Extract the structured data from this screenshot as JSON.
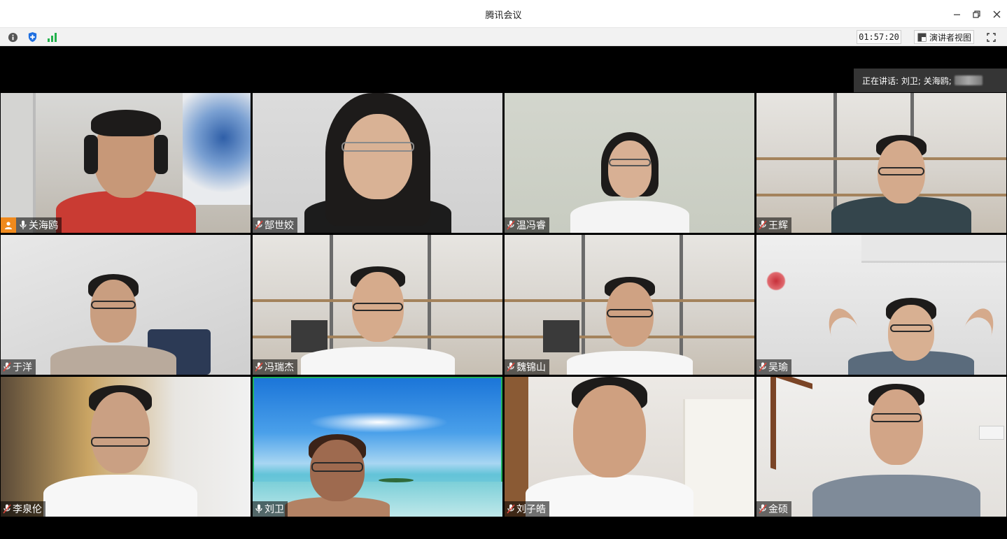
{
  "window": {
    "title": "腾讯会议",
    "minimize_icon": "minimize-icon",
    "restore_icon": "restore-icon",
    "close_icon": "close-icon"
  },
  "toolbar": {
    "info_icon": "info-icon",
    "security_icon": "shield-icon",
    "signal_icon": "signal-icon",
    "timer": "01:57:20",
    "view_mode_label": "演讲者视图",
    "fullscreen_icon": "fullscreen-icon"
  },
  "speaking": {
    "label": "正在讲话: 刘卫; 关海鸥;"
  },
  "participants": [
    {
      "name": "关海鸥",
      "host": true,
      "muted": false
    },
    {
      "name": "郜世姣",
      "host": false,
      "muted": true
    },
    {
      "name": "温冯睿",
      "host": false,
      "muted": true
    },
    {
      "name": "王辉",
      "host": false,
      "muted": true
    },
    {
      "name": "于洋",
      "host": false,
      "muted": true
    },
    {
      "name": "冯瑞杰",
      "host": false,
      "muted": true
    },
    {
      "name": "魏锦山",
      "host": false,
      "muted": true
    },
    {
      "name": "吴瑜",
      "host": false,
      "muted": true
    },
    {
      "name": "李泉伦",
      "host": false,
      "muted": true
    },
    {
      "name": "刘卫",
      "host": false,
      "muted": false,
      "active_speaker": true
    },
    {
      "name": "刘子皓",
      "host": false,
      "muted": true
    },
    {
      "name": "金硕",
      "host": false,
      "muted": true
    }
  ],
  "colors": {
    "host_badge": "#f08a1d",
    "active_border": "#1fb25a",
    "muted_mic": "#e0463c"
  }
}
